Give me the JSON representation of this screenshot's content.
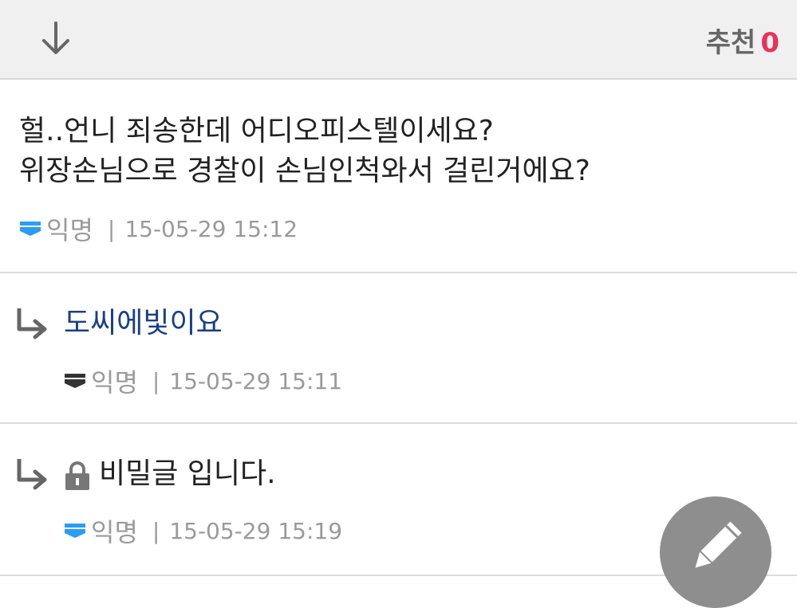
{
  "header": {
    "down_icon": "arrow-down-icon",
    "recommend_label": "추천",
    "recommend_count": "0",
    "accent_color": "#e8325a"
  },
  "comments": [
    {
      "text": "헐..언니 죄송한데 어디오피스텔이세요?\n위장손님으로 경찰이 손님인척와서 걸린거에요?",
      "author": "익명",
      "separator": "|",
      "date": "15-05-29 15:12",
      "badge_color": "#2a9df4"
    },
    {
      "text": "도씨에빛이요",
      "author": "익명",
      "separator": "|",
      "date": "15-05-29 15:11",
      "badge_color": "#333333",
      "is_reply": true
    },
    {
      "text": "비밀글 입니다.",
      "author": "익명",
      "separator": "|",
      "date": "15-05-29 15:19",
      "badge_color": "#2a9df4",
      "is_reply": true,
      "locked": true
    }
  ],
  "fab": {
    "icon": "pencil-icon",
    "color": "#8e8e8e"
  }
}
